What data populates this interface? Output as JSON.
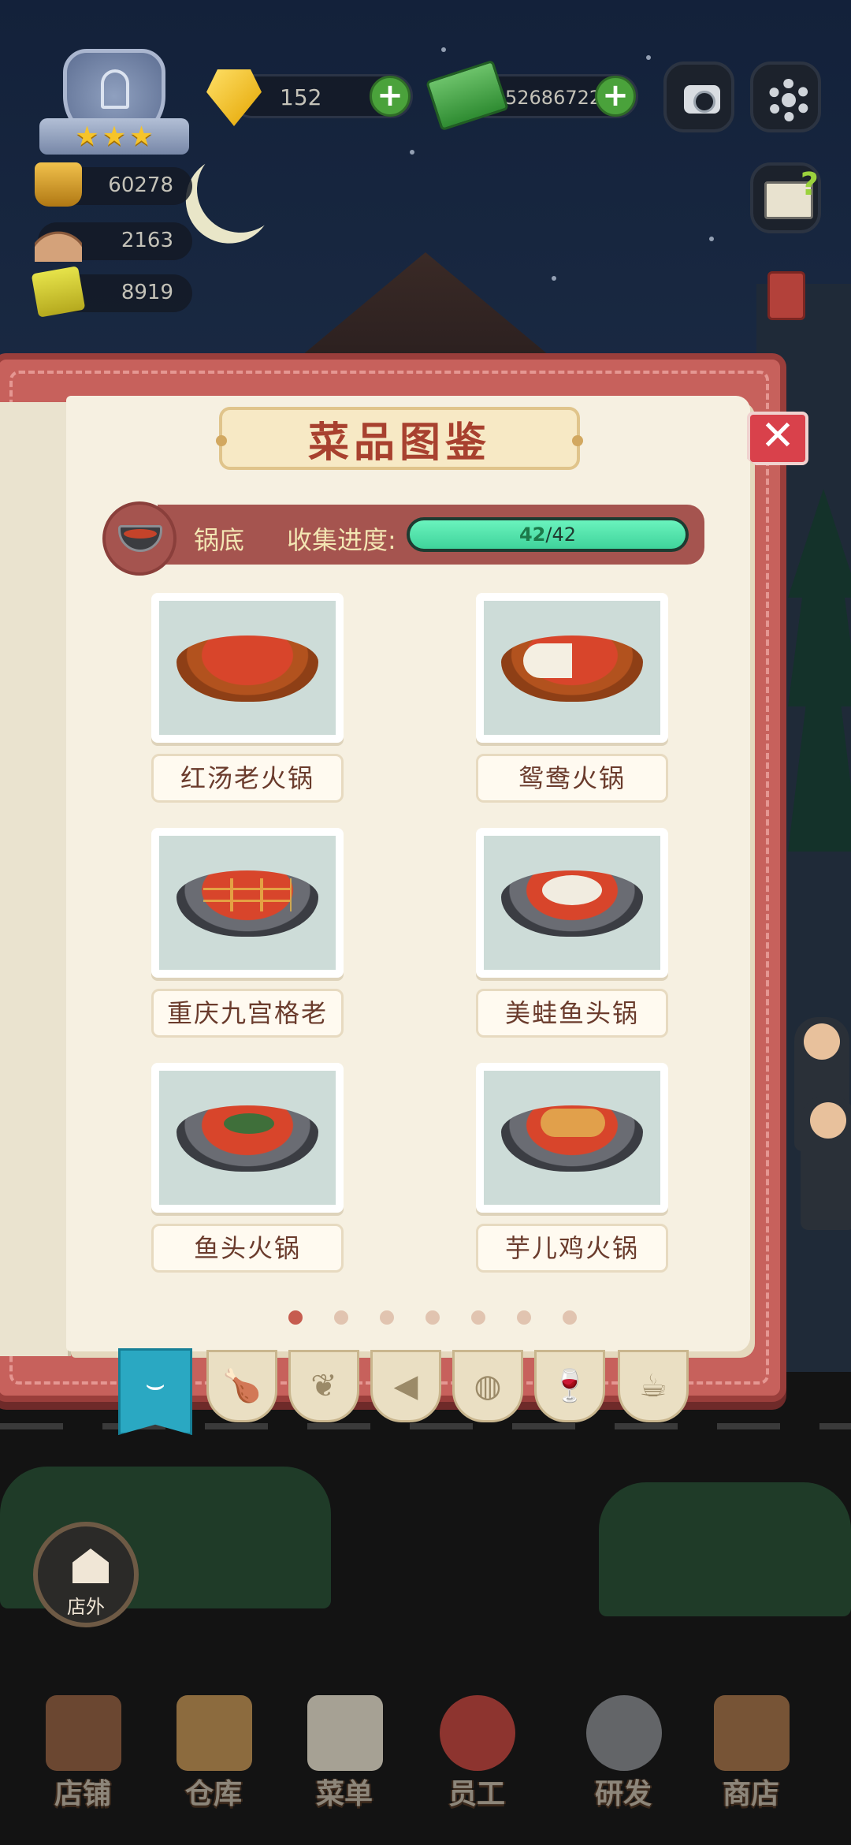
{
  "hud": {
    "gems": "152",
    "cash": "52686722",
    "stats": [
      {
        "icon": "hotpot-icon",
        "value": "60278"
      },
      {
        "icon": "cloche-icon",
        "value": "2163"
      },
      {
        "icon": "ticket-icon",
        "value": "8919"
      }
    ]
  },
  "modal": {
    "title": "菜品图鉴",
    "close": "✕",
    "category": "锅底",
    "progress_label": "收集进度:",
    "progress_current": "42",
    "progress_total": "/42",
    "progress_fraction": 1.0,
    "dishes": [
      {
        "name": "红汤老火锅",
        "style": "copper"
      },
      {
        "name": "鸳鸯火锅",
        "style": "yuan"
      },
      {
        "name": "重庆九宫格老",
        "style": "steel grid"
      },
      {
        "name": "美蛙鱼头锅",
        "style": "steel fish"
      },
      {
        "name": "鱼头火锅",
        "style": "steel fish2"
      },
      {
        "name": "芋儿鸡火锅",
        "style": "steel chicken"
      }
    ],
    "page_count": 7,
    "active_page": 1,
    "tabs": [
      {
        "icon": "hotpot-tab-icon",
        "glyph": "⌣"
      },
      {
        "icon": "drumstick-tab-icon",
        "glyph": "🍗"
      },
      {
        "icon": "broccoli-tab-icon",
        "glyph": "❦"
      },
      {
        "icon": "fish-tab-icon",
        "glyph": "◀"
      },
      {
        "icon": "bread-tab-icon",
        "glyph": "◍"
      },
      {
        "icon": "wine-tab-icon",
        "glyph": "🍷"
      },
      {
        "icon": "dessert-tab-icon",
        "glyph": "☕"
      }
    ]
  },
  "outside_button": "店外",
  "bottom_nav": [
    "店铺",
    "仓库",
    "菜单",
    "员工",
    "研发",
    "商店"
  ],
  "colors": {
    "accent_red": "#c7615c",
    "progress_green": "#4fe3ab",
    "active_tab": "#2aa8c2"
  }
}
